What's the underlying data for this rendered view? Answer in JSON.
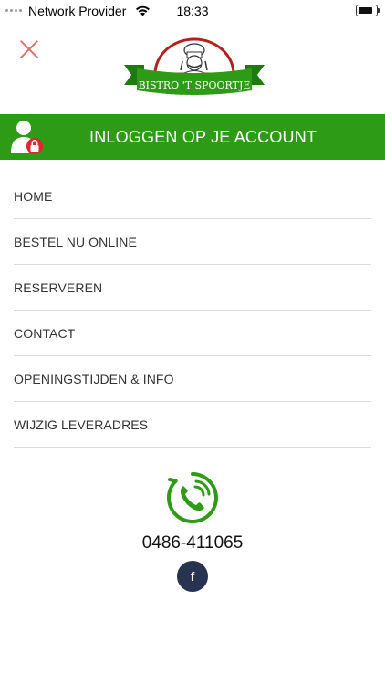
{
  "status_bar": {
    "carrier": "Network Provider",
    "time": "18:33"
  },
  "header": {
    "logo_text": "BISTRO 'T SPOORTJE"
  },
  "login": {
    "label": "INLOGGEN OP JE ACCOUNT"
  },
  "menu": {
    "items": [
      {
        "label": "HOME"
      },
      {
        "label": "BESTEL NU ONLINE"
      },
      {
        "label": "RESERVEREN"
      },
      {
        "label": "CONTACT"
      },
      {
        "label": "OPENINGSTIJDEN & INFO"
      },
      {
        "label": "WIJZIG LEVERADRES"
      }
    ]
  },
  "footer": {
    "phone": "0486-411065",
    "facebook_glyph": "f"
  },
  "colors": {
    "brand_green": "#2e9b16",
    "close_red": "#e0706c",
    "facebook_navy": "#273351",
    "lock_red": "#e0262b"
  }
}
